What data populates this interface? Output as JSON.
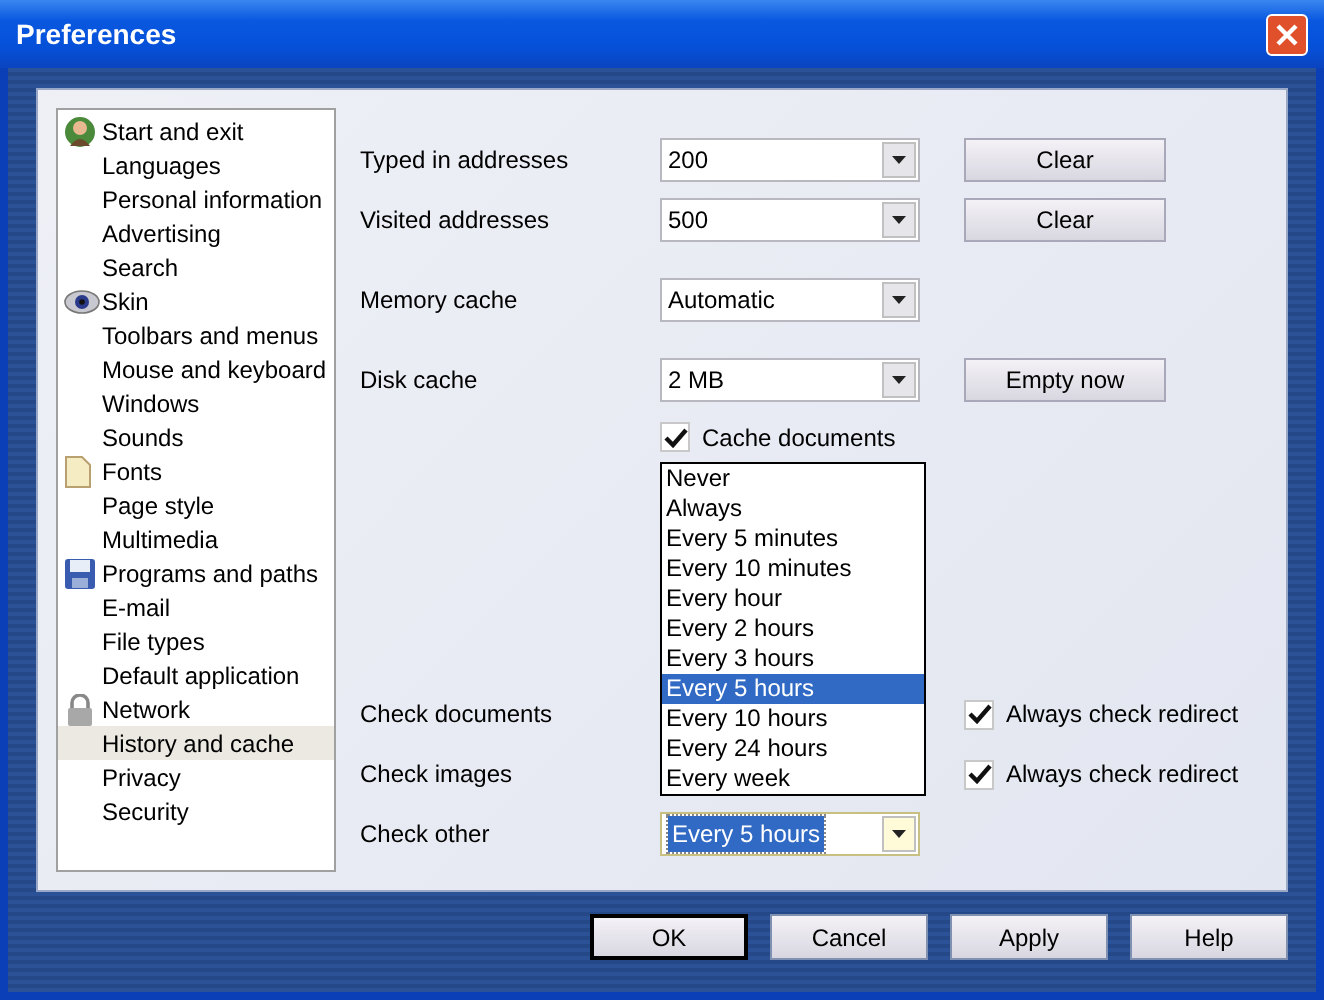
{
  "window": {
    "title": "Preferences"
  },
  "sidebar": {
    "items": [
      {
        "label": "Start and exit",
        "kind": "section",
        "selected": false
      },
      {
        "label": "Languages",
        "kind": "page",
        "selected": false
      },
      {
        "label": "Personal information",
        "kind": "page",
        "selected": false
      },
      {
        "label": "Advertising",
        "kind": "page",
        "selected": false
      },
      {
        "label": "Search",
        "kind": "page",
        "selected": false
      },
      {
        "label": "Skin",
        "kind": "section",
        "selected": false
      },
      {
        "label": "Toolbars and menus",
        "kind": "page",
        "selected": false
      },
      {
        "label": "Mouse and keyboard",
        "kind": "page",
        "selected": false
      },
      {
        "label": "Windows",
        "kind": "page",
        "selected": false
      },
      {
        "label": "Sounds",
        "kind": "page",
        "selected": false
      },
      {
        "label": "Fonts",
        "kind": "section",
        "selected": false
      },
      {
        "label": "Page style",
        "kind": "page",
        "selected": false
      },
      {
        "label": "Multimedia",
        "kind": "page",
        "selected": false
      },
      {
        "label": "Programs and paths",
        "kind": "section",
        "selected": false
      },
      {
        "label": "E-mail",
        "kind": "page",
        "selected": false
      },
      {
        "label": "File types",
        "kind": "page",
        "selected": false
      },
      {
        "label": "Default application",
        "kind": "page",
        "selected": false
      },
      {
        "label": "Network",
        "kind": "section",
        "selected": false
      },
      {
        "label": "History and cache",
        "kind": "page",
        "selected": true
      },
      {
        "label": "Privacy",
        "kind": "page",
        "selected": false
      },
      {
        "label": "Security",
        "kind": "page",
        "selected": false
      }
    ]
  },
  "settings": [
    {
      "label": "Typed in addresses",
      "value": "200",
      "button": "Clear"
    },
    {
      "label": "Visited addresses",
      "value": "500",
      "button": "Clear"
    },
    {
      "label": "Memory cache",
      "value": "Automatic"
    },
    {
      "label": "Disk cache",
      "value": "2 MB",
      "button": "Empty now"
    }
  ],
  "cache_documents": {
    "label": "Cache documents",
    "checked": true
  },
  "checks": [
    {
      "label": "Check documents",
      "redirect": {
        "label": "Always check redirect",
        "checked": true
      }
    },
    {
      "label": "Check images",
      "redirect": {
        "label": "Always check redirect",
        "checked": true
      }
    },
    {
      "label": "Check other",
      "value": "Every 5 hours",
      "open": true
    }
  ],
  "dropdown": {
    "options": [
      {
        "label": "Never",
        "selected": false
      },
      {
        "label": "Always",
        "selected": false
      },
      {
        "label": "Every 5 minutes",
        "selected": false
      },
      {
        "label": "Every 10 minutes",
        "selected": false
      },
      {
        "label": "Every hour",
        "selected": false
      },
      {
        "label": "Every 2 hours",
        "selected": false
      },
      {
        "label": "Every 3 hours",
        "selected": false
      },
      {
        "label": "Every 5 hours",
        "selected": true
      },
      {
        "label": "Every 10 hours",
        "selected": false
      },
      {
        "label": "Every 24 hours",
        "selected": false
      },
      {
        "label": "Every week",
        "selected": false
      }
    ]
  },
  "buttons": [
    {
      "label": "OK",
      "default": true
    },
    {
      "label": "Cancel",
      "default": false
    },
    {
      "label": "Apply",
      "default": false
    },
    {
      "label": "Help",
      "default": false
    }
  ]
}
